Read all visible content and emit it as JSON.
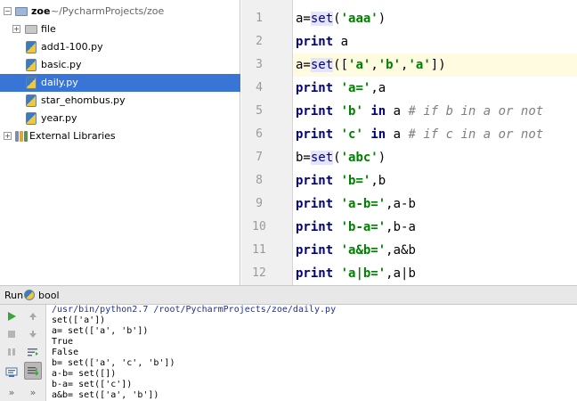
{
  "project_tree": {
    "root": {
      "name": "zoe",
      "path": "~/PycharmProjects/zoe"
    },
    "items": [
      {
        "label": "file",
        "kind": "folder"
      },
      {
        "label": "add1-100.py",
        "kind": "py"
      },
      {
        "label": "basic.py",
        "kind": "py"
      },
      {
        "label": "daily.py",
        "kind": "py",
        "selected": true
      },
      {
        "label": "star_ehombus.py",
        "kind": "py"
      },
      {
        "label": "year.py",
        "kind": "py"
      }
    ],
    "external": {
      "label": "External Libraries"
    }
  },
  "editor": {
    "line_numbers": [
      "1",
      "2",
      "3",
      "4",
      "5",
      "6",
      "7",
      "8",
      "9",
      "10",
      "11",
      "12"
    ],
    "current_line": "3"
  },
  "run": {
    "title": "Run",
    "config_name": "bool",
    "console": [
      "/usr/bin/python2.7 /root/PycharmProjects/zoe/daily.py",
      "set(['a'])",
      "a= set(['a', 'b'])",
      "True",
      "False",
      "b= set(['a', 'c', 'b'])",
      "a-b= set([])",
      "b-a= set(['c'])",
      "a&b= set(['a', 'b'])"
    ]
  },
  "colors": {
    "selection": "#3875d7",
    "keyword": "#000080",
    "string": "#008000",
    "comment": "#808080",
    "run_green": "#3aa33a"
  }
}
